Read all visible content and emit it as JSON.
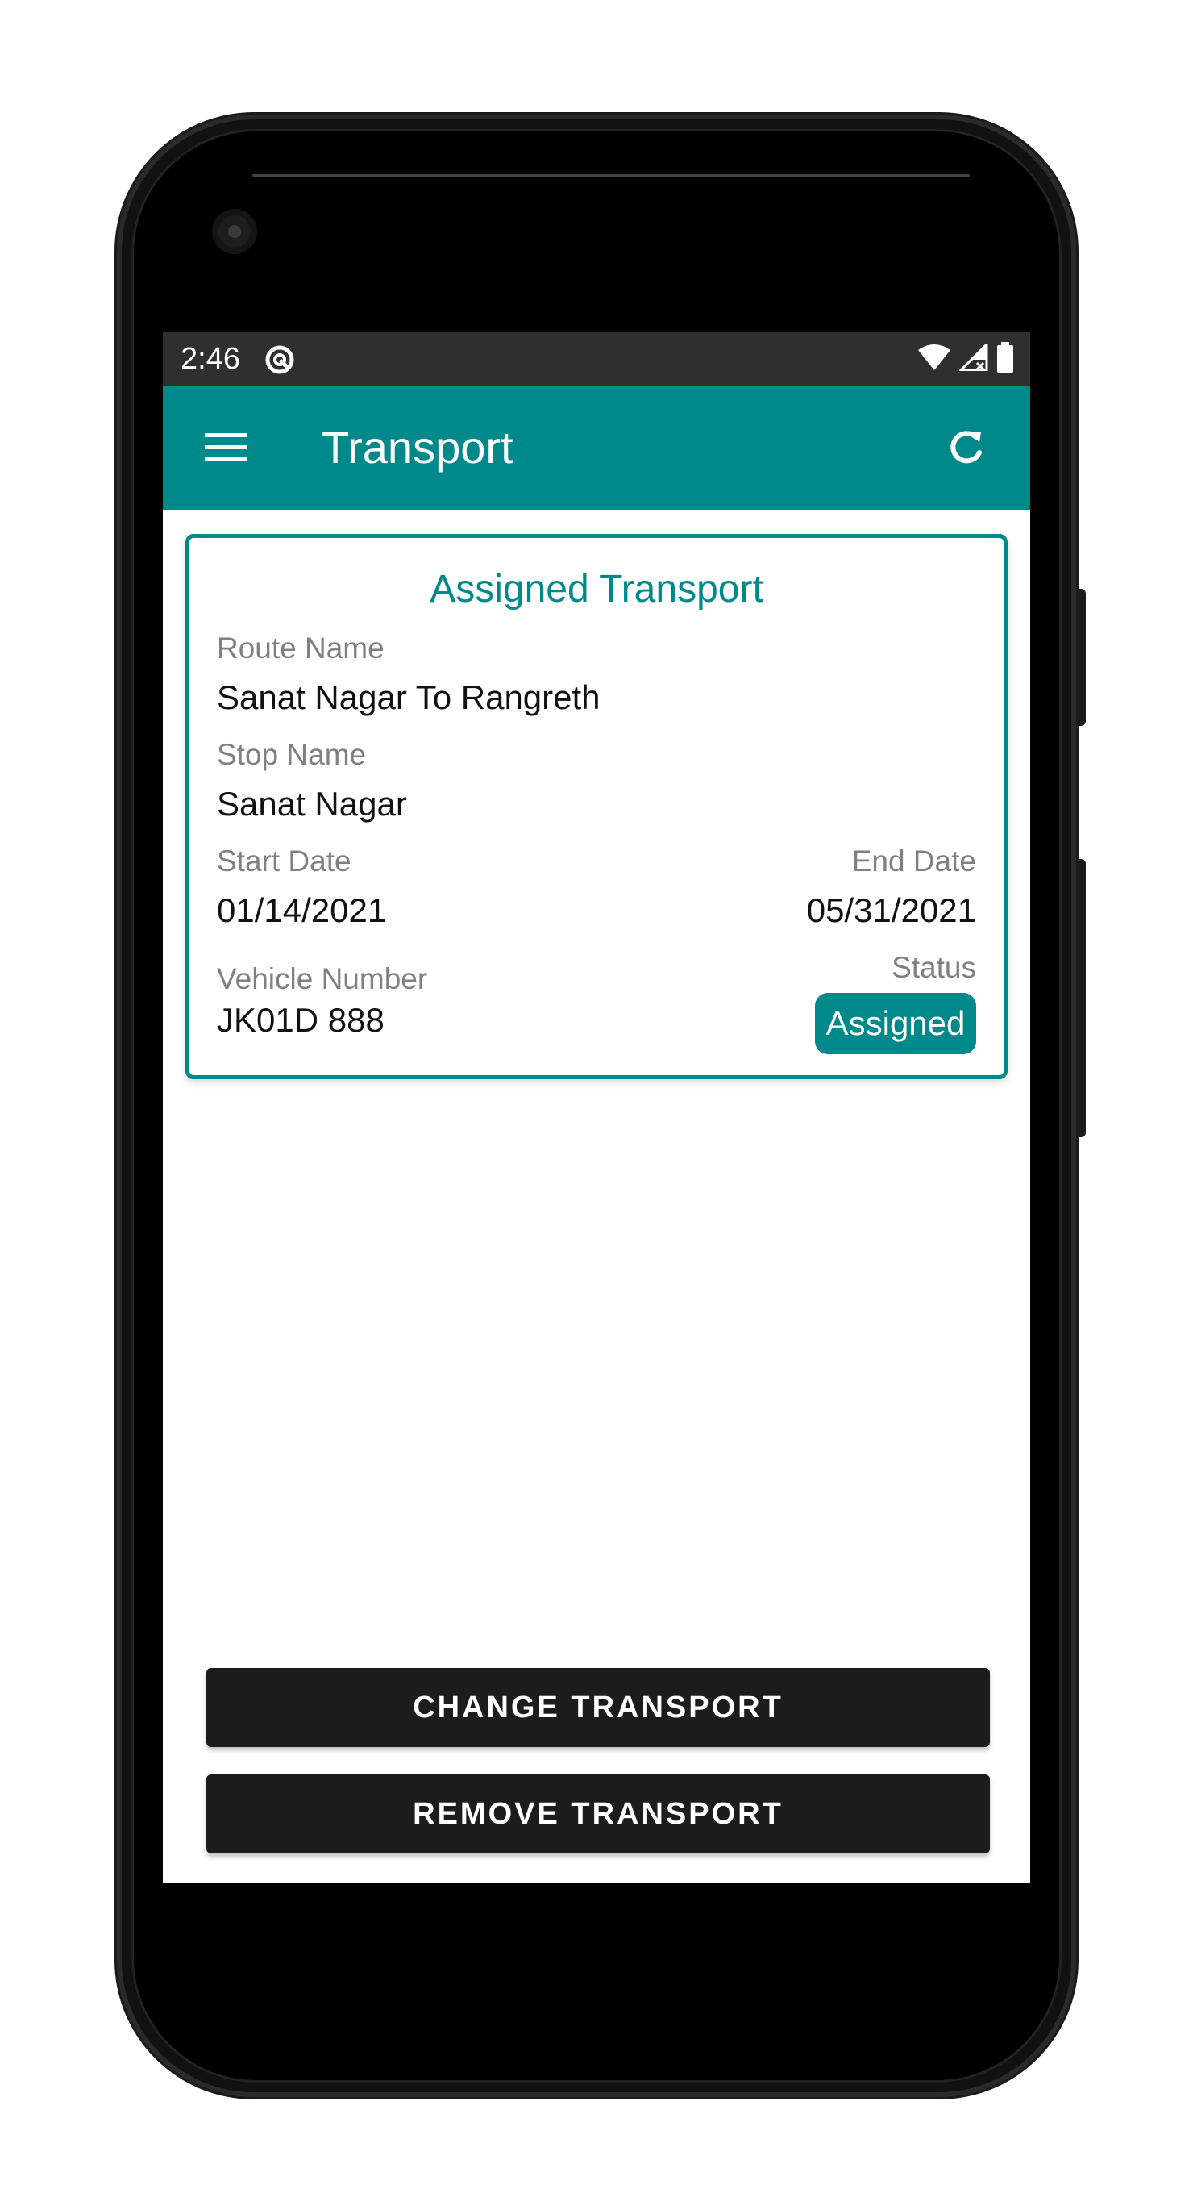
{
  "status_bar": {
    "time": "2:46",
    "icons": [
      "app-notification-icon",
      "wifi-icon",
      "cellular-signal-icon",
      "battery-icon"
    ]
  },
  "app_bar": {
    "title": "Transport",
    "menu_icon": "hamburger-menu-icon",
    "refresh_icon": "refresh-icon",
    "color": "#00898a"
  },
  "card": {
    "title": "Assigned Transport",
    "route_label": "Route Name",
    "route_value": "Sanat Nagar To Rangreth",
    "stop_label": "Stop Name",
    "stop_value": "Sanat Nagar",
    "start_date_label": "Start Date",
    "start_date_value": "01/14/2021",
    "end_date_label": "End Date",
    "end_date_value": "05/31/2021",
    "vehicle_label": "Vehicle Number",
    "vehicle_value": "JK01D 888",
    "status_label": "Status",
    "status_value": "Assigned"
  },
  "actions": {
    "change_label": "CHANGE TRANSPORT",
    "remove_label": "REMOVE TRANSPORT"
  }
}
